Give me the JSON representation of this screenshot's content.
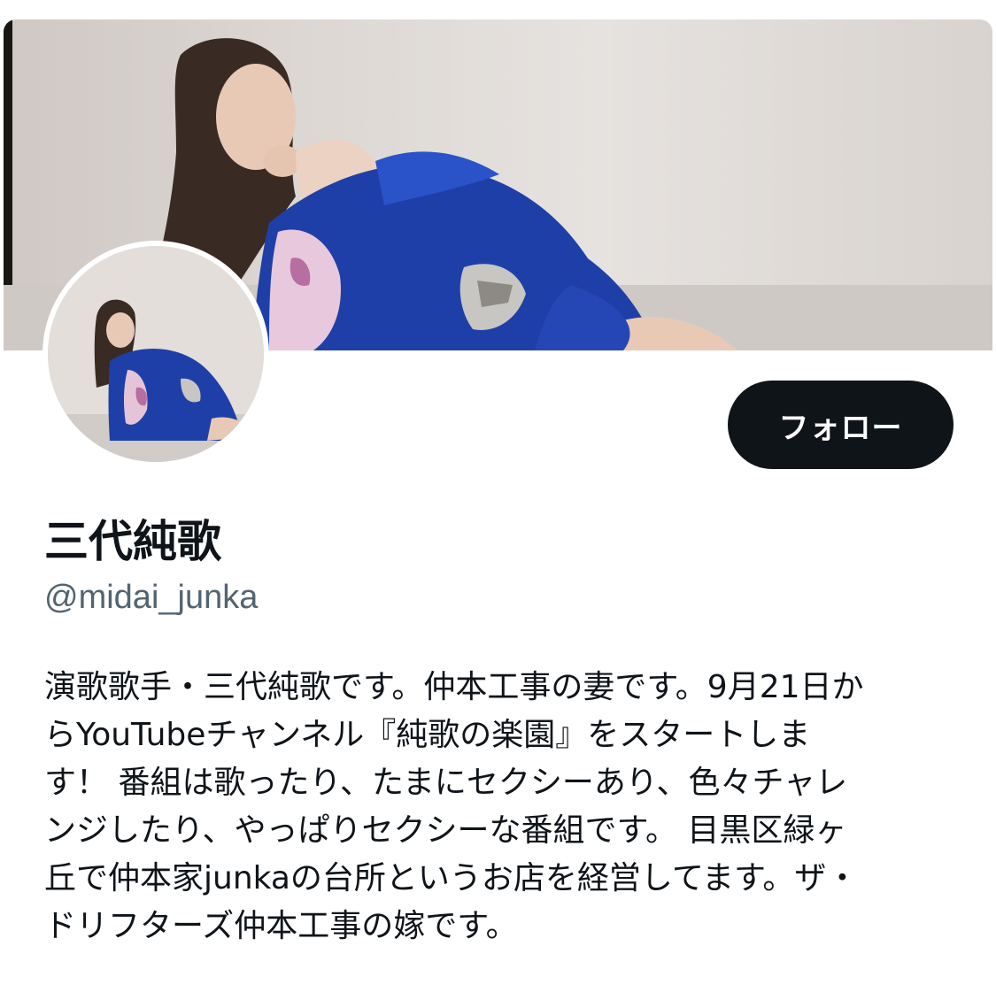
{
  "profile": {
    "display_name": "三代純歌",
    "handle": "@midai_junka",
    "follow_label": "フォロー",
    "bio_lines": [
      "演歌歌手・三代純歌です。仲本工事の妻です。9月21日か",
      "らYouTubeチャンネル『純歌の楽園』をスタートしま",
      "す！ 番組は歌ったり、たまにセクシーあり、色々チャレ",
      "ンジしたり、やっぱりセクシーな番組です。 目黒区緑ヶ",
      "丘で仲本家junkaの台所というお店を経営してます。ザ・",
      "ドリフターズ仲本工事の嫁です。"
    ]
  },
  "colors": {
    "button_bg": "#0f1419",
    "button_text": "#ffffff",
    "primary_text": "#0f1419",
    "secondary_text": "#536471",
    "kimono_blue": "#1f3fa8"
  }
}
